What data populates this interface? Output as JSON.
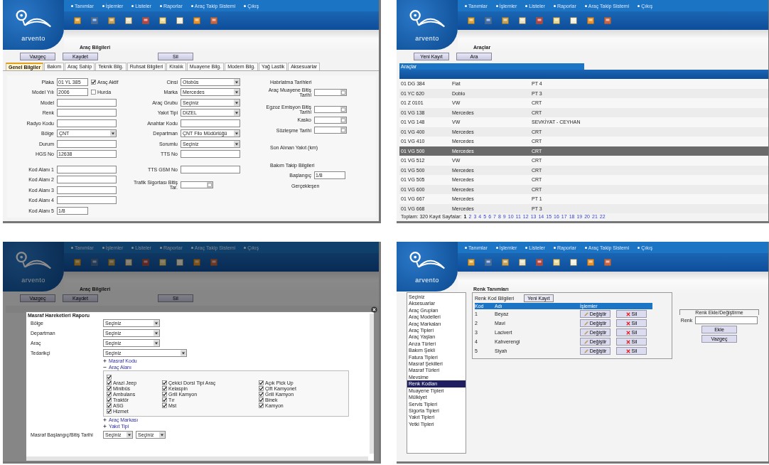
{
  "screens": [
    {
      "kind": "vehicle_form",
      "logo": "arvento",
      "menu": [
        "Tanımlar",
        "İşlemler",
        "Listeler",
        "Raporlar",
        "Araç Takip Sistemi",
        "Çıkış"
      ],
      "title": "Araç Bilgileri",
      "buttons": [
        "Vazgeç",
        "Kaydet",
        "Sil"
      ],
      "tabs": [
        {
          "label": "Genel Bilgiler",
          "selected": true
        },
        {
          "label": "Bakım",
          "selected": false
        },
        {
          "label": "Araç Sahip",
          "selected": false
        },
        {
          "label": "Teknik Bilg.",
          "selected": false
        },
        {
          "label": "Ruhsat Bilgileri",
          "selected": false
        },
        {
          "label": "Kiralık",
          "selected": false
        },
        {
          "label": "Muayene Bilg.",
          "selected": false
        },
        {
          "label": "Modem Bilg.",
          "selected": false
        },
        {
          "label": "Yağ Lastik",
          "selected": false
        },
        {
          "label": "Aksesuarlar",
          "selected": false
        }
      ],
      "columns": [
        [
          {
            "kind": "input",
            "label": "Plaka",
            "value": "01 YL 385",
            "short": true,
            "check": {
              "label": "Araç Aktif",
              "checked": true
            }
          },
          {
            "kind": "input",
            "label": "Model Yılı",
            "value": "2006",
            "short": true,
            "check": {
              "label": "Hurda",
              "checked": false
            }
          },
          {
            "kind": "input",
            "label": "Model"
          },
          {
            "kind": "input",
            "label": "Renk"
          },
          {
            "kind": "input",
            "label": "Radyo Kodu"
          },
          {
            "kind": "select",
            "label": "Bölge",
            "value": "ÇNT"
          },
          {
            "kind": "input",
            "label": "Durum"
          },
          {
            "kind": "input",
            "label": "HGS No",
            "value": "12638"
          },
          {
            "kind": "gap"
          },
          {
            "kind": "input",
            "label": "Kod Alanı 1"
          },
          {
            "kind": "input",
            "label": "Kod Alanı 2"
          },
          {
            "kind": "input",
            "label": "Kod Alanı 3"
          },
          {
            "kind": "input",
            "label": "Kod Alanı 4"
          },
          {
            "kind": "input",
            "label": "Kod Alanı 5",
            "value": "1/8",
            "short": true
          }
        ],
        [
          {
            "kind": "select",
            "label": "Cinsi",
            "value": "Otobüs"
          },
          {
            "kind": "select",
            "label": "Marka",
            "value": "Mercedes"
          },
          {
            "kind": "select",
            "label": "Araç Grubu",
            "value": "Seçiniz"
          },
          {
            "kind": "select",
            "label": "Yakıt Tipi",
            "value": "DİZEL"
          },
          {
            "kind": "input",
            "label": "Anahtar Kodu"
          },
          {
            "kind": "select",
            "label": "Departman",
            "value": "ÇNT Filo Müdürlüğü"
          },
          {
            "kind": "select",
            "label": "Sorumlu",
            "value": "Seçiniz"
          },
          {
            "kind": "input",
            "label": "TTS No"
          },
          {
            "kind": "gap"
          },
          {
            "kind": "input",
            "label": "TTS GSM No"
          },
          {
            "kind": "gap"
          },
          {
            "kind": "date",
            "label": "Trafik Sigortası Bitiş Tar."
          }
        ],
        [
          {
            "kind": "heading",
            "label": "Hatırlatma Tarihleri"
          },
          {
            "kind": "date",
            "label": "Araç Muayene Bitiş Tarihi"
          },
          {
            "kind": "gap"
          },
          {
            "kind": "date",
            "label": "Egzoz Emisyon Bitiş Tarihi"
          },
          {
            "kind": "date",
            "label": "Kasko"
          },
          {
            "kind": "date",
            "label": "Sözleşme Tarihi"
          },
          {
            "kind": "gap"
          },
          {
            "kind": "heading",
            "label": "Son Alınan Yakıt (km)"
          },
          {
            "kind": "gap"
          },
          {
            "kind": "heading",
            "label": "Bakım Takip Bilgileri"
          },
          {
            "kind": "input",
            "label": "Başlangıç",
            "value": "1/8",
            "short": true
          },
          {
            "kind": "text",
            "label": "Gerçekleşen"
          }
        ]
      ]
    },
    {
      "kind": "vehicle_list",
      "logo": "arvento",
      "menu": [
        "Tanımlar",
        "İşlemler",
        "Listeler",
        "Raporlar",
        "Araç Takip Sistemi",
        "Çıkış"
      ],
      "title": "Araçlar",
      "buttons": [
        "Yeni Kayıt",
        "Ara"
      ],
      "group": "Araçlar",
      "rows": [
        {
          "cells": [
            "01 DG 384",
            "Fiat",
            "PT 4"
          ],
          "selected": false
        },
        {
          "cells": [
            "01 YC 620",
            "Doblo",
            "PT 3"
          ],
          "selected": false
        },
        {
          "cells": [
            "01 Z 0101",
            "VW",
            "CRT"
          ],
          "selected": false
        },
        {
          "cells": [
            "01 VG 138",
            "Mercedes",
            "CRT"
          ],
          "selected": false
        },
        {
          "cells": [
            "01 VG 148",
            "VW",
            "SEVKİYAT - CEYHAN"
          ],
          "selected": false
        },
        {
          "cells": [
            "01 VG 400",
            "Mercedes",
            "CRT"
          ],
          "selected": false
        },
        {
          "cells": [
            "01 VG 410",
            "Mercedes",
            "CRT"
          ],
          "selected": false
        },
        {
          "cells": [
            "01 VG 500",
            "Mercedes",
            "CRT"
          ],
          "selected": true
        },
        {
          "cells": [
            "01 VG 512",
            "VW",
            "CRT"
          ],
          "selected": false
        },
        {
          "cells": [
            "01 VG 500",
            "Mercedes",
            "CRT"
          ],
          "selected": false
        },
        {
          "cells": [
            "01 VG 505",
            "Mercedes",
            "CRT"
          ],
          "selected": false
        },
        {
          "cells": [
            "01 VG 600",
            "Mercedes",
            "CRT"
          ],
          "selected": false
        },
        {
          "cells": [
            "01 VG 667",
            "Mercedes",
            "PT 1"
          ],
          "selected": false
        },
        {
          "cells": [
            "01 VG 668",
            "Mercedes",
            "PT 3"
          ],
          "selected": false
        }
      ],
      "footer": "Toplam: 320 Kayıt Sayfalar:",
      "pages": [
        {
          "label": "1",
          "selected": true
        },
        {
          "label": "2",
          "selected": false
        },
        {
          "label": "3",
          "selected": false
        },
        {
          "label": "4",
          "selected": false
        },
        {
          "label": "5",
          "selected": false
        },
        {
          "label": "6",
          "selected": false
        },
        {
          "label": "7",
          "selected": false
        },
        {
          "label": "8",
          "selected": false
        },
        {
          "label": "9",
          "selected": false
        },
        {
          "label": "10",
          "selected": false
        },
        {
          "label": "11",
          "selected": false
        },
        {
          "label": "12",
          "selected": false
        },
        {
          "label": "13",
          "selected": false
        },
        {
          "label": "14",
          "selected": false
        },
        {
          "label": "15",
          "selected": false
        },
        {
          "label": "16",
          "selected": false
        },
        {
          "label": "17",
          "selected": false
        },
        {
          "label": "18",
          "selected": false
        },
        {
          "label": "19",
          "selected": false
        },
        {
          "label": "20",
          "selected": false
        },
        {
          "label": "21",
          "selected": false
        },
        {
          "label": "22",
          "selected": false
        }
      ]
    },
    {
      "kind": "report_modal",
      "logo": "arvento",
      "menu": [
        "Tanımlar",
        "İşlemler",
        "Listeler",
        "Raporlar",
        "Araç Takip Sistemi",
        "Çıkış"
      ],
      "title": "Araç Bilgileri",
      "buttons": [
        "Vazgeç",
        "Kaydet",
        "Sil"
      ],
      "modal": {
        "title": "Masraf Hareketleri Raporu",
        "filters": [
          {
            "label": "Bölge",
            "value": "Seçiniz"
          },
          {
            "label": "Departman",
            "value": "Seçiniz"
          },
          {
            "label": "Araç",
            "value": "Seçiniz"
          },
          {
            "label": "Tedarikçi",
            "value": "Seçiniz",
            "wide": true
          }
        ],
        "sections": [
          {
            "label": "Masraf Kodu",
            "expanded": false
          },
          {
            "label": "Araç Alanı",
            "expanded": true,
            "all_checked": true,
            "options": [
              {
                "label": "Arazi Jeep",
                "checked": true
              },
              {
                "label": "Çekici Dorsi Tipi Araç",
                "checked": true
              },
              {
                "label": "Açık Pick Up",
                "checked": true
              },
              {
                "label": "Minibüs",
                "checked": true
              },
              {
                "label": "Kelaspin",
                "checked": true
              },
              {
                "label": "Çift Kamyonet",
                "checked": true
              },
              {
                "label": "Ambulans",
                "checked": true
              },
              {
                "label": "Grill Kamyon",
                "checked": true
              },
              {
                "label": "Grill Kamyon",
                "checked": true
              },
              {
                "label": "Traktör",
                "checked": true
              },
              {
                "label": "Tır",
                "checked": true
              },
              {
                "label": "Binek",
                "checked": true
              },
              {
                "label": "ASG",
                "checked": true
              },
              {
                "label": "Mst",
                "checked": true
              },
              {
                "label": "Kamyon",
                "checked": true
              },
              {
                "label": "Hizmet",
                "checked": true
              }
            ]
          },
          {
            "label": "Araç Markası",
            "expanded": false
          },
          {
            "label": "Yakıt Tipi",
            "expanded": false
          }
        ],
        "date_label": "Masraf Başlangıç/Bitiş Tarihi",
        "date_values": [
          "Seçiniz",
          "Seçiniz"
        ]
      }
    },
    {
      "kind": "definitions",
      "logo": "arvento",
      "menu": [
        "Tanımlar",
        "İşlemler",
        "Listeler",
        "Raporlar",
        "Araç Takip Sistemi",
        "Çıkış"
      ],
      "title": "Renk Tanımları",
      "sidebar": [
        {
          "label": "Seçiniz",
          "selected": false
        },
        {
          "label": "Aksesuarlar",
          "selected": false
        },
        {
          "label": "Araç Grupları",
          "selected": false
        },
        {
          "label": "Araç Modelleri",
          "selected": false
        },
        {
          "label": "Araç Markaları",
          "selected": false
        },
        {
          "label": "Araç Tipleri",
          "selected": false
        },
        {
          "label": "Araç Yaşları",
          "selected": false
        },
        {
          "label": "Arıza Türleri",
          "selected": false
        },
        {
          "label": "Bakım Şekli",
          "selected": false
        },
        {
          "label": "Fatura Tipleri",
          "selected": false
        },
        {
          "label": "Masraf Şekilleri",
          "selected": false
        },
        {
          "label": "Masraf Türleri",
          "selected": false
        },
        {
          "label": "Mevsime",
          "selected": false
        },
        {
          "label": "Renk Kodları",
          "selected": true
        },
        {
          "label": "Muayene Tipleri",
          "selected": false
        },
        {
          "label": "Mülkiyet",
          "selected": false
        },
        {
          "label": "Servis Tipleri",
          "selected": false
        },
        {
          "label": "Sigorta Tipleri",
          "selected": false
        },
        {
          "label": "Yakıt Tipleri",
          "selected": false
        },
        {
          "label": "Yetki Tipleri",
          "selected": false
        }
      ],
      "panel": {
        "title": "Renk Kod Bilgileri",
        "new_button": "Yeni Kayıt",
        "columns": [
          "Kod",
          "Adı",
          "İşlemler"
        ],
        "rows": [
          {
            "code": "1",
            "name": "Beyaz",
            "edit": "Değiştir",
            "delete": "Sil"
          },
          {
            "code": "2",
            "name": "Mavi",
            "edit": "Değiştir",
            "delete": "Sil"
          },
          {
            "code": "3",
            "name": "Lacivert",
            "edit": "Değiştir",
            "delete": "Sil"
          },
          {
            "code": "4",
            "name": "Kahverengi",
            "edit": "Değiştir",
            "delete": "Sil"
          },
          {
            "code": "5",
            "name": "Siyah",
            "edit": "Değiştir",
            "delete": "Sil"
          }
        ]
      },
      "editor": {
        "title": "Renk Ekle/Değiştirme",
        "label": "Renk",
        "buttons": [
          "Ekle",
          "Vazgeç"
        ]
      }
    }
  ]
}
